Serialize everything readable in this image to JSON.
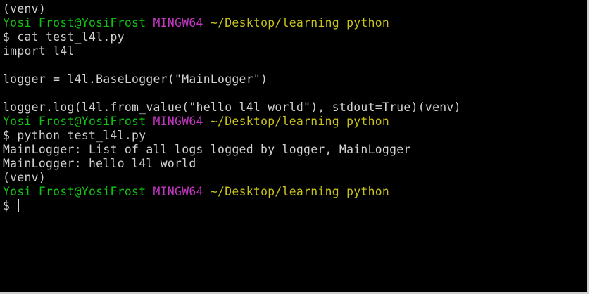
{
  "colors": {
    "background": "#000000",
    "text": "#d2d2d2",
    "user_host": "#12c312",
    "shell_name": "#c338c3",
    "path": "#c9c31a"
  },
  "terminal": {
    "lines": [
      {
        "segments": [
          {
            "text": "(venv)",
            "color": "default"
          }
        ]
      },
      {
        "segments": [
          {
            "text": "Yosi Frost@YosiFrost ",
            "color": "green"
          },
          {
            "text": "MINGW64 ",
            "color": "magenta"
          },
          {
            "text": "~/Desktop/learning python",
            "color": "yellow"
          }
        ]
      },
      {
        "segments": [
          {
            "text": "$ cat test_l4l.py",
            "color": "default"
          }
        ]
      },
      {
        "segments": [
          {
            "text": "import l4l",
            "color": "default"
          }
        ]
      },
      {
        "segments": [
          {
            "text": "",
            "color": "default"
          }
        ]
      },
      {
        "segments": [
          {
            "text": "logger = l4l.BaseLogger(\"MainLogger\")",
            "color": "default"
          }
        ]
      },
      {
        "segments": [
          {
            "text": "",
            "color": "default"
          }
        ]
      },
      {
        "segments": [
          {
            "text": "logger.log(l4l.from_value(\"hello l4l world\"), stdout=True)(venv)",
            "color": "default"
          }
        ]
      },
      {
        "segments": [
          {
            "text": "Yosi Frost@YosiFrost ",
            "color": "green"
          },
          {
            "text": "MINGW64 ",
            "color": "magenta"
          },
          {
            "text": "~/Desktop/learning python",
            "color": "yellow"
          }
        ]
      },
      {
        "segments": [
          {
            "text": "$ python test_l4l.py",
            "color": "default"
          }
        ]
      },
      {
        "segments": [
          {
            "text": "MainLogger: List of all logs logged by logger, MainLogger",
            "color": "default"
          }
        ]
      },
      {
        "segments": [
          {
            "text": "MainLogger: hello l4l world",
            "color": "default"
          }
        ]
      },
      {
        "segments": [
          {
            "text": "(venv)",
            "color": "default"
          }
        ]
      },
      {
        "segments": [
          {
            "text": "Yosi Frost@YosiFrost ",
            "color": "green"
          },
          {
            "text": "MINGW64 ",
            "color": "magenta"
          },
          {
            "text": "~/Desktop/learning python",
            "color": "yellow"
          }
        ]
      },
      {
        "segments": [
          {
            "text": "$ ",
            "color": "default"
          }
        ],
        "cursor": true
      }
    ]
  }
}
